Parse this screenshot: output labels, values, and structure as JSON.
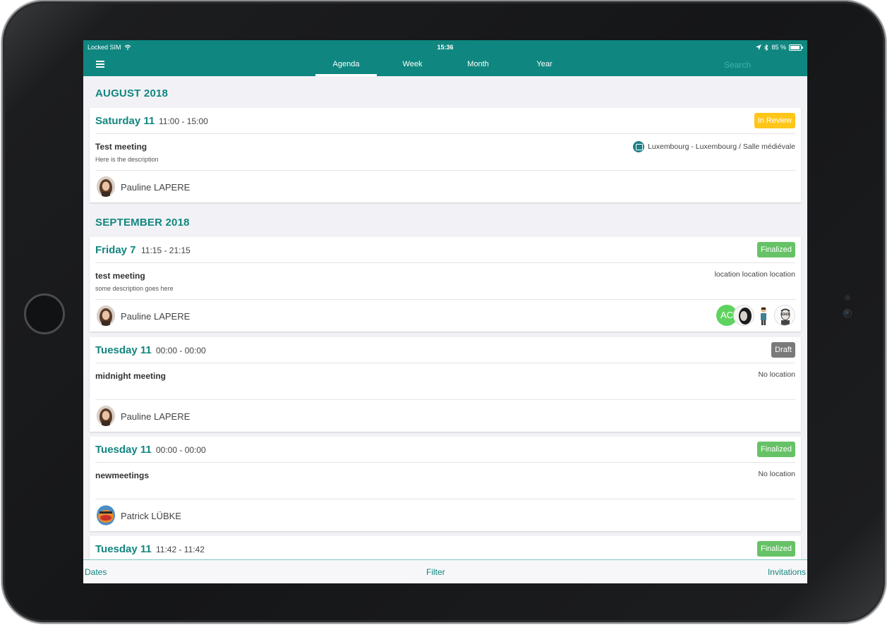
{
  "status_bar": {
    "carrier": "Locked SIM",
    "time": "15:36",
    "battery": "85 %"
  },
  "nav": {
    "tabs": [
      {
        "label": "Agenda",
        "active": true
      },
      {
        "label": "Week",
        "active": false
      },
      {
        "label": "Month",
        "active": false
      },
      {
        "label": "Year",
        "active": false
      }
    ],
    "search_placeholder": "Search"
  },
  "months": [
    {
      "label": "AUGUST 2018",
      "events": [
        {
          "day": "Saturday 11",
          "time": "11:00 - 15:00",
          "status": "In Review",
          "title": "Test meeting",
          "description": "Here is the description",
          "location": "Luxembourg - Luxembourg / Salle médiévale",
          "owner": "Pauline LAPERE"
        }
      ]
    },
    {
      "label": "SEPTEMBER 2018",
      "events": [
        {
          "day": "Friday 7",
          "time": "11:15 - 21:15",
          "status": "Finalized",
          "title": "test meeting",
          "description": "some description goes here",
          "location": "location location location",
          "owner": "Pauline LAPERE",
          "participants": [
            "AC"
          ]
        },
        {
          "day": "Tuesday 11",
          "time": "00:00 - 00:00",
          "status": "Draft",
          "title": "midnight meeting",
          "description": "",
          "location": "No location",
          "owner": "Pauline LAPERE"
        },
        {
          "day": "Tuesday 11",
          "time": "00:00 - 00:00",
          "status": "Finalized",
          "title": "newmeetings",
          "description": "",
          "location": "No location",
          "owner": "Patrick LÜBKE"
        },
        {
          "day": "Tuesday 11",
          "time": "11:42 - 11:42",
          "status": "Finalized"
        }
      ]
    }
  ],
  "bottom_bar": {
    "dates": "Dates",
    "filter": "Filter",
    "invitations": "Invitations"
  },
  "colors": {
    "brand": "#0f8780",
    "accent_text": "#12867f",
    "in_review": "#ffc61a",
    "finalized": "#66c266",
    "draft": "#7a7a7a"
  }
}
